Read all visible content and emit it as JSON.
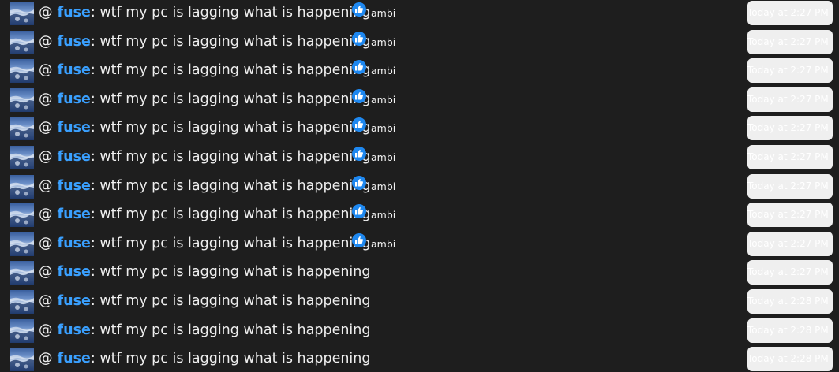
{
  "messages": [
    {
      "at": "@",
      "user": "fuse",
      "text": ": wtf my pc is lagging what is happening",
      "reactor": "ambi",
      "reaction_icon": "thumbs-up-icon",
      "timestamp": "Today at 2:27 PM"
    },
    {
      "at": "@",
      "user": "fuse",
      "text": ": wtf my pc is lagging what is happening",
      "reactor": "ambi",
      "reaction_icon": "thumbs-up-icon",
      "timestamp": "Today at 2:27 PM"
    },
    {
      "at": "@",
      "user": "fuse",
      "text": ": wtf my pc is lagging what is happening",
      "reactor": "ambi",
      "reaction_icon": "thumbs-up-icon",
      "timestamp": "Today at 2:27 PM"
    },
    {
      "at": "@",
      "user": "fuse",
      "text": ": wtf my pc is lagging what is happening",
      "reactor": "ambi",
      "reaction_icon": "thumbs-up-icon",
      "timestamp": "Today at 2:27 PM"
    },
    {
      "at": "@",
      "user": "fuse",
      "text": ": wtf my pc is lagging what is happening",
      "reactor": "ambi",
      "reaction_icon": "thumbs-up-icon",
      "timestamp": "Today at 2:27 PM"
    },
    {
      "at": "@",
      "user": "fuse",
      "text": ": wtf my pc is lagging what is happening",
      "reactor": "ambi",
      "reaction_icon": "thumbs-up-icon",
      "timestamp": "Today at 2:27 PM"
    },
    {
      "at": "@",
      "user": "fuse",
      "text": ": wtf my pc is lagging what is happening",
      "reactor": "ambi",
      "reaction_icon": "thumbs-up-icon",
      "timestamp": "Today at 2:27 PM"
    },
    {
      "at": "@",
      "user": "fuse",
      "text": ": wtf my pc is lagging what is happening",
      "reactor": "ambi",
      "reaction_icon": "thumbs-up-icon",
      "timestamp": "Today at 2:27 PM"
    },
    {
      "at": "@",
      "user": "fuse",
      "text": ": wtf my pc is lagging what is happening",
      "reactor": "ambi",
      "reaction_icon": "thumbs-up-icon",
      "timestamp": "Today at 2:27 PM"
    },
    {
      "at": "@",
      "user": "fuse",
      "text": ": wtf my pc is lagging what is happening",
      "reactor": null,
      "timestamp": "Today at 2:27 PM"
    },
    {
      "at": "@",
      "user": "fuse",
      "text": ": wtf my pc is lagging what is happening",
      "reactor": null,
      "timestamp": "Today at 2:28 PM"
    },
    {
      "at": "@",
      "user": "fuse",
      "text": ": wtf my pc is lagging what is happening",
      "reactor": null,
      "timestamp": "Today at 2:28 PM"
    },
    {
      "at": "@",
      "user": "fuse",
      "text": ": wtf my pc is lagging what is happening",
      "reactor": null,
      "timestamp": "Today at 2:28 PM"
    }
  ],
  "colors": {
    "background": "#1e1e1e",
    "username": "#3aa0ff",
    "reaction": "#1e88f0",
    "timestamp_bg": "#efefef"
  }
}
